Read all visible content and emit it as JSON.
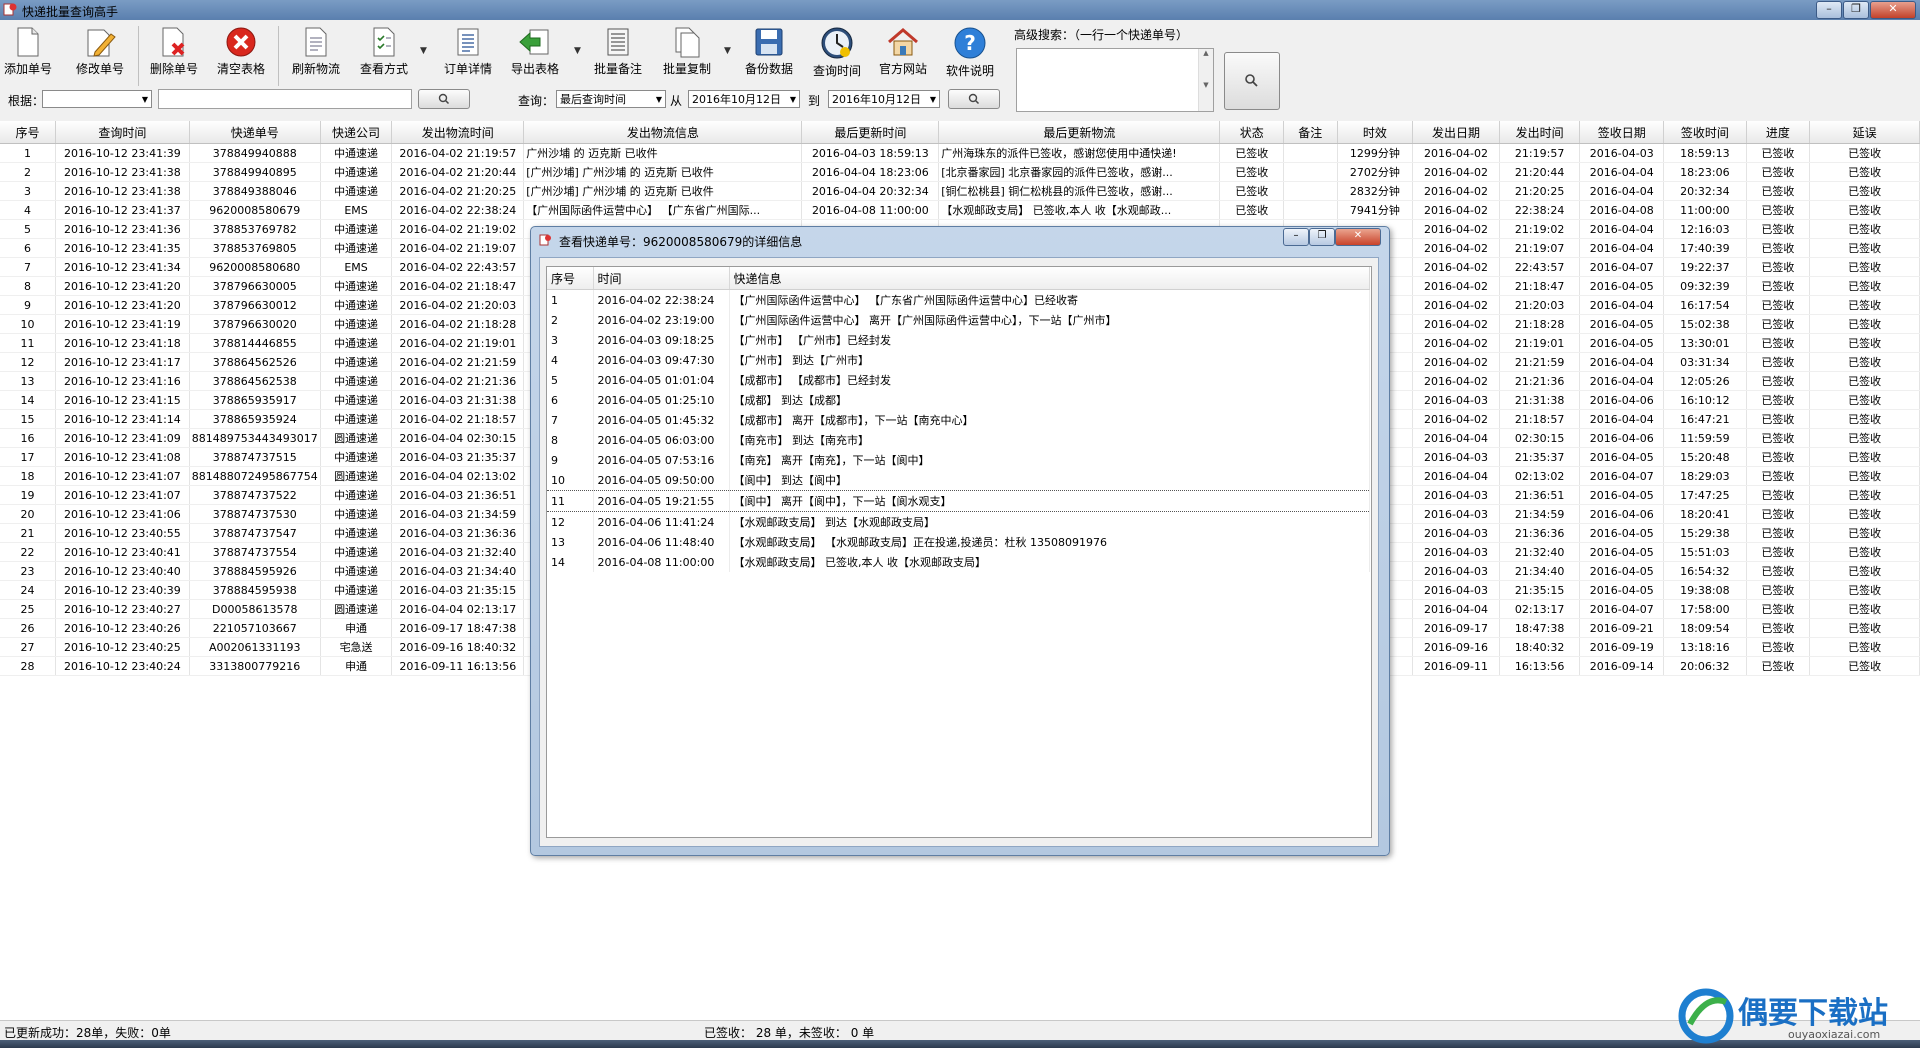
{
  "window": {
    "title": "快递批量查询高手",
    "controls": [
      "minimize-icon",
      "maximize-icon",
      "close-icon"
    ]
  },
  "toolbar": {
    "buttons": [
      {
        "label": "添加单号",
        "icon": "add-document-icon"
      },
      {
        "label": "修改单号",
        "icon": "edit-document-icon"
      },
      {
        "label": "删除单号",
        "icon": "delete-document-icon"
      },
      {
        "label": "清空表格",
        "icon": "clear-table-icon"
      },
      {
        "label": "刷新物流",
        "icon": "refresh-document-icon"
      },
      {
        "label": "查看方式",
        "icon": "view-mode-icon"
      },
      {
        "label": "订单详情",
        "icon": "order-detail-icon"
      },
      {
        "label": "导出表格",
        "icon": "export-arrow-icon"
      },
      {
        "label": "批量备注",
        "icon": "batch-note-icon"
      },
      {
        "label": "批量复制",
        "icon": "batch-copy-icon"
      },
      {
        "label": "备份数据",
        "icon": "floppy-disk-icon"
      },
      {
        "label": "查询时间",
        "icon": "clock-icon"
      },
      {
        "label": "官方网站",
        "icon": "home-icon"
      },
      {
        "label": "软件说明",
        "icon": "help-icon"
      }
    ],
    "advanced_search_label": "高级搜索：（一行一个快递单号）",
    "filter_label": "根据：",
    "filter_value": "",
    "query_label": "查询：",
    "query_value": "最后查询时间",
    "from_label": "从",
    "from_date": "2016年10月12日",
    "to_label": "到",
    "to_date": "2016年10月12日"
  },
  "grid": {
    "columns": [
      "序号",
      "查询时间",
      "快递单号",
      "快递公司",
      "发出物流时间",
      "发出物流信息",
      "最后更新时间",
      "最后更新物流",
      "状态",
      "备注",
      "时效",
      "发出日期",
      "发出时间",
      "签收日期",
      "签收时间",
      "进度",
      "延误"
    ],
    "rows": [
      [
        "1",
        "2016-10-12 23:41:39",
        "378849940888",
        "中通速递",
        "2016-04-02 21:19:57",
        "广州沙埔 的 迈克斯 已收件",
        "2016-04-03 18:59:13",
        "广州海珠东的派件已签收，感谢您使用中通快递!",
        "已签收",
        "",
        "1299分钟",
        "2016-04-02",
        "21:19:57",
        "2016-04-03",
        "18:59:13",
        "已签收",
        "已签收"
      ],
      [
        "2",
        "2016-10-12 23:41:38",
        "378849940895",
        "中通速递",
        "2016-04-02 21:20:44",
        "[广州沙埔] 广州沙埔 的 迈克斯 已收件",
        "2016-04-04 18:23:06",
        "[北京番家园] 北京番家园的派件已签收，感谢...",
        "已签收",
        "",
        "2702分钟",
        "2016-04-02",
        "21:20:44",
        "2016-04-04",
        "18:23:06",
        "已签收",
        "已签收"
      ],
      [
        "3",
        "2016-10-12 23:41:38",
        "378849388046",
        "中通速递",
        "2016-04-02 21:20:25",
        "[广州沙埔] 广州沙埔 的 迈克斯 已收件",
        "2016-04-04 20:32:34",
        "[铜仁松桃县] 铜仁松桃县的派件已签收，感谢...",
        "已签收",
        "",
        "2832分钟",
        "2016-04-02",
        "21:20:25",
        "2016-04-04",
        "20:32:34",
        "已签收",
        "已签收"
      ],
      [
        "4",
        "2016-10-12 23:41:37",
        "9620008580679",
        "EMS",
        "2016-04-02 22:38:24",
        "【广州国际函件运营中心】 【广东省广州国际...",
        "2016-04-08 11:00:00",
        "【水观邮政支局】 已签收,本人 收【水观邮政...",
        "已签收",
        "",
        "7941分钟",
        "2016-04-02",
        "22:38:24",
        "2016-04-08",
        "11:00:00",
        "已签收",
        "已签收"
      ],
      [
        "5",
        "2016-10-12 23:41:36",
        "378853769782",
        "中通速递",
        "2016-04-02 21:19:02",
        "",
        "",
        "",
        "",
        "",
        "",
        "2016-04-02",
        "21:19:02",
        "2016-04-04",
        "12:16:03",
        "已签收",
        "已签收"
      ],
      [
        "6",
        "2016-10-12 23:41:35",
        "378853769805",
        "中通速递",
        "2016-04-02 21:19:07",
        "",
        "",
        "",
        "",
        "",
        "",
        "2016-04-02",
        "21:19:07",
        "2016-04-04",
        "17:40:39",
        "已签收",
        "已签收"
      ],
      [
        "7",
        "2016-10-12 23:41:34",
        "9620008580680",
        "EMS",
        "2016-04-02 22:43:57",
        "",
        "",
        "",
        "",
        "",
        "",
        "2016-04-02",
        "22:43:57",
        "2016-04-07",
        "19:22:37",
        "已签收",
        "已签收"
      ],
      [
        "8",
        "2016-10-12 23:41:20",
        "378796630005",
        "中通速递",
        "2016-04-02 21:18:47",
        "",
        "",
        "",
        "",
        "",
        "",
        "2016-04-02",
        "21:18:47",
        "2016-04-05",
        "09:32:39",
        "已签收",
        "已签收"
      ],
      [
        "9",
        "2016-10-12 23:41:20",
        "378796630012",
        "中通速递",
        "2016-04-02 21:20:03",
        "",
        "",
        "",
        "",
        "",
        "",
        "2016-04-02",
        "21:20:03",
        "2016-04-04",
        "16:17:54",
        "已签收",
        "已签收"
      ],
      [
        "10",
        "2016-10-12 23:41:19",
        "378796630020",
        "中通速递",
        "2016-04-02 21:18:28",
        "",
        "",
        "",
        "",
        "",
        "",
        "2016-04-02",
        "21:18:28",
        "2016-04-05",
        "15:02:38",
        "已签收",
        "已签收"
      ],
      [
        "11",
        "2016-10-12 23:41:18",
        "378814446855",
        "中通速递",
        "2016-04-02 21:19:01",
        "",
        "",
        "",
        "",
        "",
        "",
        "2016-04-02",
        "21:19:01",
        "2016-04-05",
        "13:30:01",
        "已签收",
        "已签收"
      ],
      [
        "12",
        "2016-10-12 23:41:17",
        "378864562526",
        "中通速递",
        "2016-04-02 21:21:59",
        "",
        "",
        "",
        "",
        "",
        "",
        "2016-04-02",
        "21:21:59",
        "2016-04-04",
        "03:31:34",
        "已签收",
        "已签收"
      ],
      [
        "13",
        "2016-10-12 23:41:16",
        "378864562538",
        "中通速递",
        "2016-04-02 21:21:36",
        "",
        "",
        "",
        "",
        "",
        "",
        "2016-04-02",
        "21:21:36",
        "2016-04-04",
        "12:05:26",
        "已签收",
        "已签收"
      ],
      [
        "14",
        "2016-10-12 23:41:15",
        "378865935917",
        "中通速递",
        "2016-04-03 21:31:38",
        "",
        "",
        "",
        "",
        "",
        "",
        "2016-04-03",
        "21:31:38",
        "2016-04-06",
        "16:10:12",
        "已签收",
        "已签收"
      ],
      [
        "15",
        "2016-10-12 23:41:14",
        "378865935924",
        "中通速递",
        "2016-04-02 21:18:57",
        "",
        "",
        "",
        "",
        "",
        "",
        "2016-04-02",
        "21:18:57",
        "2016-04-04",
        "16:47:21",
        "已签收",
        "已签收"
      ],
      [
        "16",
        "2016-10-12 23:41:09",
        "881489753443493017",
        "圆通速递",
        "2016-04-04 02:30:15",
        "",
        "",
        "",
        "",
        "",
        "",
        "2016-04-04",
        "02:30:15",
        "2016-04-06",
        "11:59:59",
        "已签收",
        "已签收"
      ],
      [
        "17",
        "2016-10-12 23:41:08",
        "378874737515",
        "中通速递",
        "2016-04-03 21:35:37",
        "",
        "",
        "",
        "",
        "",
        "",
        "2016-04-03",
        "21:35:37",
        "2016-04-05",
        "15:20:48",
        "已签收",
        "已签收"
      ],
      [
        "18",
        "2016-10-12 23:41:07",
        "881488072495867754",
        "圆通速递",
        "2016-04-04 02:13:02",
        "",
        "",
        "",
        "",
        "",
        "",
        "2016-04-04",
        "02:13:02",
        "2016-04-07",
        "18:29:03",
        "已签收",
        "已签收"
      ],
      [
        "19",
        "2016-10-12 23:41:07",
        "378874737522",
        "中通速递",
        "2016-04-03 21:36:51",
        "",
        "",
        "",
        "",
        "",
        "",
        "2016-04-03",
        "21:36:51",
        "2016-04-05",
        "17:47:25",
        "已签收",
        "已签收"
      ],
      [
        "20",
        "2016-10-12 23:41:06",
        "378874737530",
        "中通速递",
        "2016-04-03 21:34:59",
        "",
        "",
        "",
        "",
        "",
        "",
        "2016-04-03",
        "21:34:59",
        "2016-04-06",
        "18:20:41",
        "已签收",
        "已签收"
      ],
      [
        "21",
        "2016-10-12 23:40:55",
        "378874737547",
        "中通速递",
        "2016-04-03 21:36:36",
        "",
        "",
        "",
        "",
        "",
        "",
        "2016-04-03",
        "21:36:36",
        "2016-04-05",
        "15:29:38",
        "已签收",
        "已签收"
      ],
      [
        "22",
        "2016-10-12 23:40:41",
        "378874737554",
        "中通速递",
        "2016-04-03 21:32:40",
        "",
        "",
        "",
        "",
        "",
        "",
        "2016-04-03",
        "21:32:40",
        "2016-04-05",
        "15:51:03",
        "已签收",
        "已签收"
      ],
      [
        "23",
        "2016-10-12 23:40:40",
        "378884595926",
        "中通速递",
        "2016-04-03 21:34:40",
        "",
        "",
        "",
        "",
        "",
        "",
        "2016-04-03",
        "21:34:40",
        "2016-04-05",
        "16:54:32",
        "已签收",
        "已签收"
      ],
      [
        "24",
        "2016-10-12 23:40:39",
        "378884595938",
        "中通速递",
        "2016-04-03 21:35:15",
        "",
        "",
        "",
        "",
        "",
        "",
        "2016-04-03",
        "21:35:15",
        "2016-04-05",
        "19:38:08",
        "已签收",
        "已签收"
      ],
      [
        "25",
        "2016-10-12 23:40:27",
        "D00058613578",
        "圆通速递",
        "2016-04-04 02:13:17",
        "",
        "",
        "",
        "",
        "",
        "",
        "2016-04-04",
        "02:13:17",
        "2016-04-07",
        "17:58:00",
        "已签收",
        "已签收"
      ],
      [
        "26",
        "2016-10-12 23:40:26",
        "221057103667",
        "申通",
        "2016-09-17 18:47:38",
        "",
        "",
        "",
        "",
        "",
        "",
        "2016-09-17",
        "18:47:38",
        "2016-09-21",
        "18:09:54",
        "已签收",
        "已签收"
      ],
      [
        "27",
        "2016-10-12 23:40:25",
        "A002061331193",
        "宅急送",
        "2016-09-16 18:40:32",
        "",
        "",
        "",
        "",
        "",
        "",
        "2016-09-16",
        "18:40:32",
        "2016-09-19",
        "13:18:16",
        "已签收",
        "已签收"
      ],
      [
        "28",
        "2016-10-12 23:40:24",
        "3313800779216",
        "申通",
        "2016-09-11 16:13:56",
        "",
        "",
        "",
        "",
        "",
        "",
        "2016-09-11",
        "16:13:56",
        "2016-09-14",
        "20:06:32",
        "已签收",
        "已签收"
      ]
    ]
  },
  "popup": {
    "title": "查看快递单号：9620008580679的详细信息",
    "columns": [
      "序号",
      "时间",
      "快递信息"
    ],
    "rows": [
      [
        "1",
        "2016-04-02 22:38:24",
        "【广州国际函件运营中心】 【广东省广州国际函件运营中心】已经收寄"
      ],
      [
        "2",
        "2016-04-02 23:19:00",
        "【广州国际函件运营中心】 离开【广州国际函件运营中心】，下一站【广州市】"
      ],
      [
        "3",
        "2016-04-03 09:18:25",
        "【广州市】 【广州市】已经封发"
      ],
      [
        "4",
        "2016-04-03 09:47:30",
        "【广州市】 到达【广州市】"
      ],
      [
        "5",
        "2016-04-05 01:01:04",
        "【成都市】 【成都市】已经封发"
      ],
      [
        "6",
        "2016-04-05 01:25:10",
        "【成都】 到达【成都】"
      ],
      [
        "7",
        "2016-04-05 01:45:32",
        "【成都市】 离开【成都市】，下一站【南充中心】"
      ],
      [
        "8",
        "2016-04-05 06:03:00",
        "【南充市】 到达【南充市】"
      ],
      [
        "9",
        "2016-04-05 07:53:16",
        "【南充】 离开【南充】，下一站【阆中】"
      ],
      [
        "10",
        "2016-04-05 09:50:00",
        "【阆中】 到达【阆中】"
      ],
      [
        "11",
        "2016-04-05 19:21:55",
        "【阆中】 离开【阆中】，下一站【阆水观支】"
      ],
      [
        "12",
        "2016-04-06 11:41:24",
        "【水观邮政支局】 到达【水观邮政支局】"
      ],
      [
        "13",
        "2016-04-06 11:48:40",
        "【水观邮政支局】 【水观邮政支局】正在投递,投递员：杜秋 13508091976"
      ],
      [
        "14",
        "2016-04-08 11:00:00",
        "【水观邮政支局】 已签收,本人 收【水观邮政支局】"
      ]
    ],
    "selected_row": 11
  },
  "status": {
    "left": "已更新成功：28单，失败：0单",
    "right": "已签收： 28 单，未签收： 0 单"
  },
  "watermark": {
    "text": "偶要下载站",
    "sub": "ouyaoxiazai.com"
  },
  "colors": {
    "titlebar": "#6a8dbb",
    "popup_frame": "#b9cde4",
    "close_red": "#c9432a"
  }
}
